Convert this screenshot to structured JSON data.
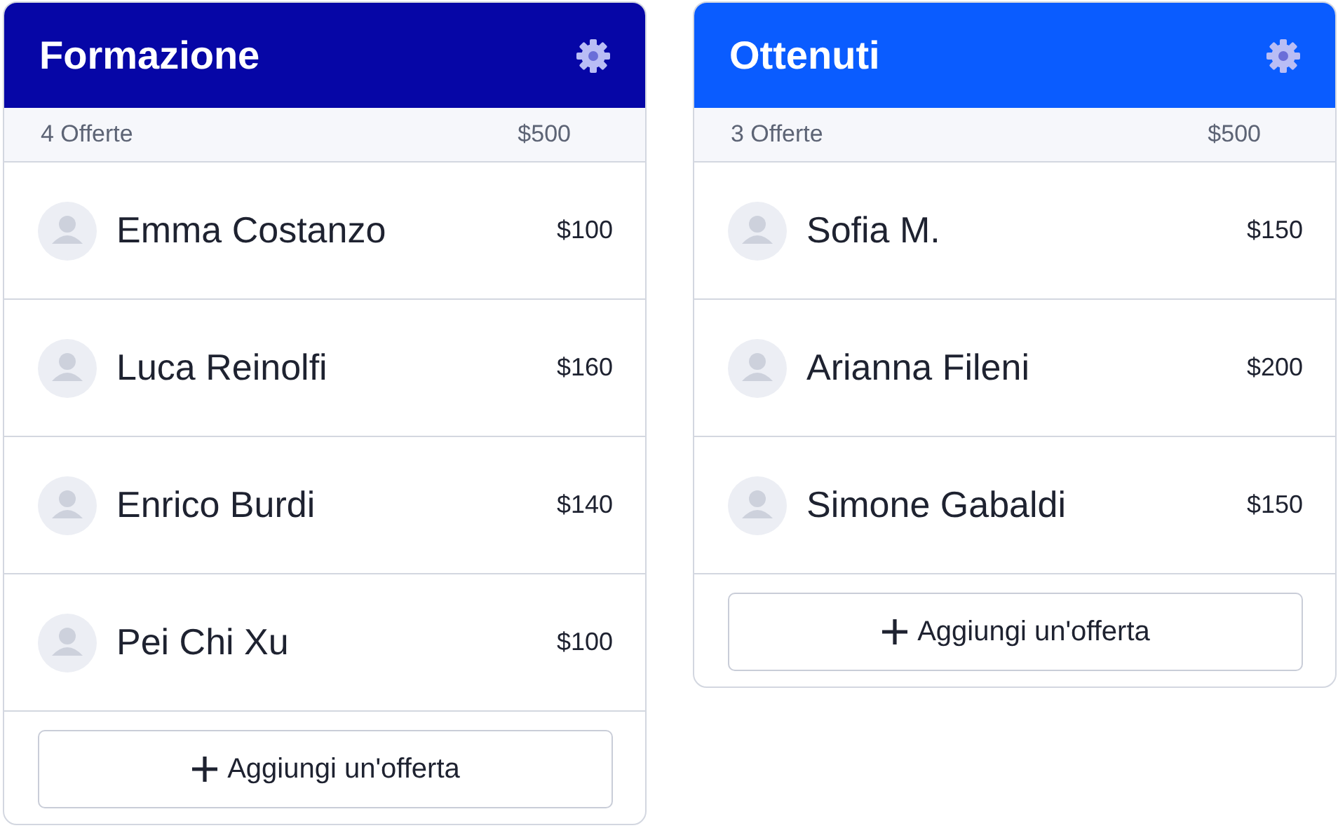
{
  "columns": [
    {
      "title": "Formazione",
      "color": "#0606a6",
      "count": "4 Offerte",
      "total": "$500",
      "offers": [
        {
          "name": "Emma Costanzo",
          "amount": "$100"
        },
        {
          "name": "Luca Reinolfi",
          "amount": "$160"
        },
        {
          "name": "Enrico Burdi",
          "amount": "$140"
        },
        {
          "name": "Pei Chi Xu",
          "amount": "$100"
        }
      ],
      "add_button": "Aggiungi un'offerta"
    },
    {
      "title": "Ottenuti",
      "color": "#0a5cff",
      "count": "3 Offerte",
      "total": "$500",
      "offers": [
        {
          "name": "Sofia M.",
          "amount": "$150"
        },
        {
          "name": "Arianna Fileni",
          "amount": "$200"
        },
        {
          "name": "Simone Gabaldi",
          "amount": "$150"
        }
      ],
      "add_button": "Aggiungi un'offerta"
    }
  ]
}
